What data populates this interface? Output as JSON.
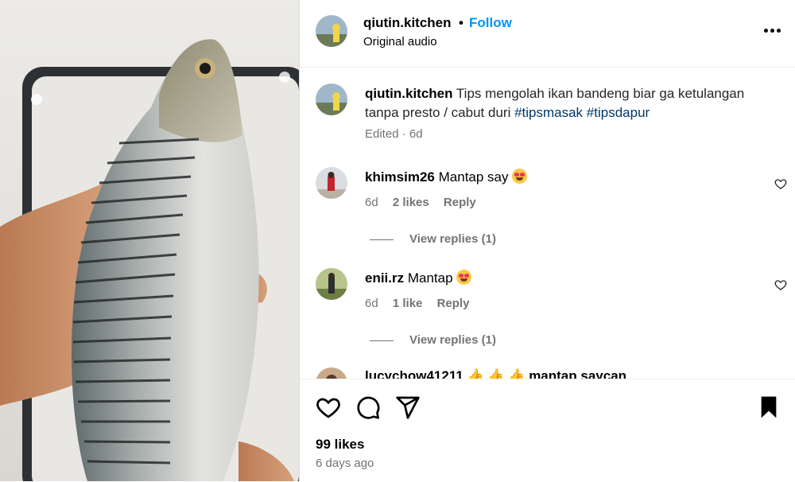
{
  "post": {
    "username": "qiutin.kitchen",
    "follow_label": "Follow",
    "separator": "•",
    "audio": "Original audio"
  },
  "caption": {
    "username": "qiutin.kitchen",
    "text": "Tips mengolah ikan bandeng biar ga ketulangan tanpa presto / cabut duri",
    "tags": [
      "#tipsmasak",
      "#tipsdapur"
    ],
    "meta": "Edited · 6d"
  },
  "comments": [
    {
      "username": "khimsim26",
      "text": "Mantap say",
      "emoji": "heart-eyes",
      "age": "6d",
      "likes": "2 likes",
      "reply": "Reply",
      "view_replies": "View replies (1)"
    },
    {
      "username": "enii.rz",
      "text": "Mantap",
      "emoji": "heart-eyes",
      "age": "6d",
      "likes": "1 like",
      "reply": "Reply",
      "view_replies": "View replies (1)"
    }
  ],
  "partial_comment": "lucychow41211 👍 👍 👍 mantap saycan",
  "footer": {
    "likes": "99 likes",
    "time_ago": "6 days ago"
  },
  "icons": [
    "more-icon",
    "heart-icon",
    "comment-icon",
    "share-icon",
    "bookmark-icon"
  ],
  "colors": {
    "link": "#0095f6",
    "hashtag": "#00376b",
    "muted": "#737373"
  }
}
